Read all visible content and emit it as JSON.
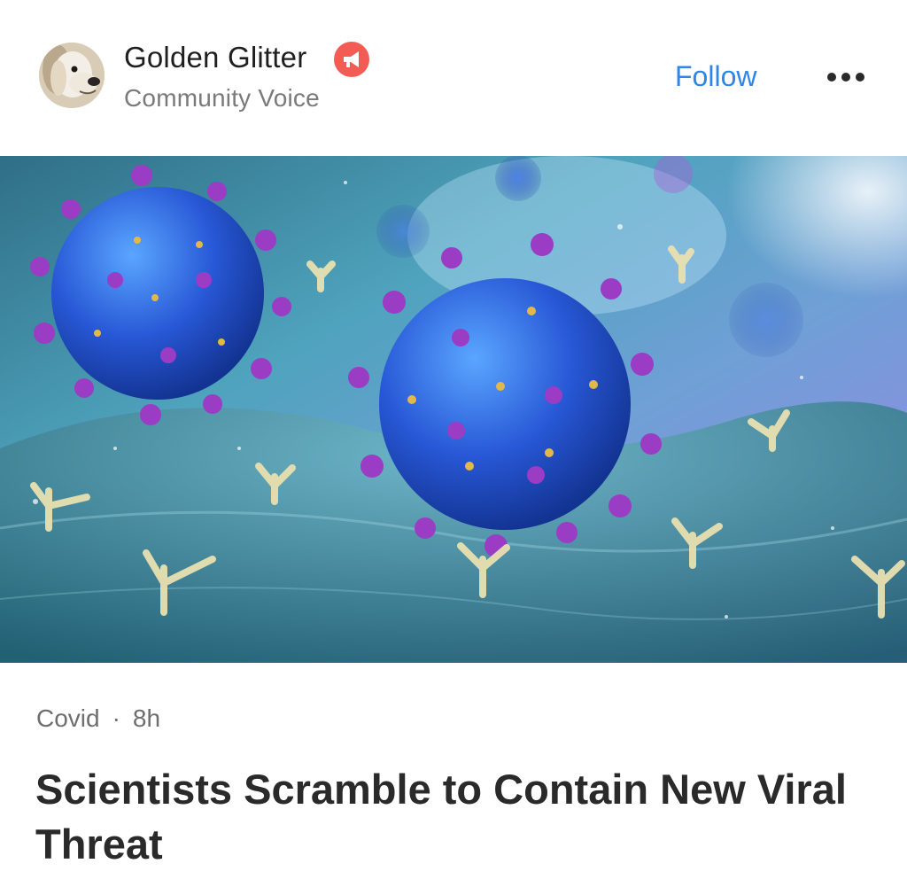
{
  "author": {
    "name": "Golden Glitter",
    "role": "Community Voice",
    "avatar_icon": "dog-avatar",
    "badge_icon": "megaphone-icon",
    "badge_color": "#f25c54"
  },
  "actions": {
    "follow_label": "Follow",
    "more_icon": "more-dots-icon"
  },
  "hero_image": {
    "subject": "virus-illustration"
  },
  "article": {
    "category": "Covid",
    "separator": "·",
    "age": "8h",
    "headline": "Scientists Scramble to Contain New Viral Threat"
  },
  "colors": {
    "follow": "#2f86e8",
    "headline": "#2a2a2a",
    "secondary_text": "#7a7a7a"
  }
}
